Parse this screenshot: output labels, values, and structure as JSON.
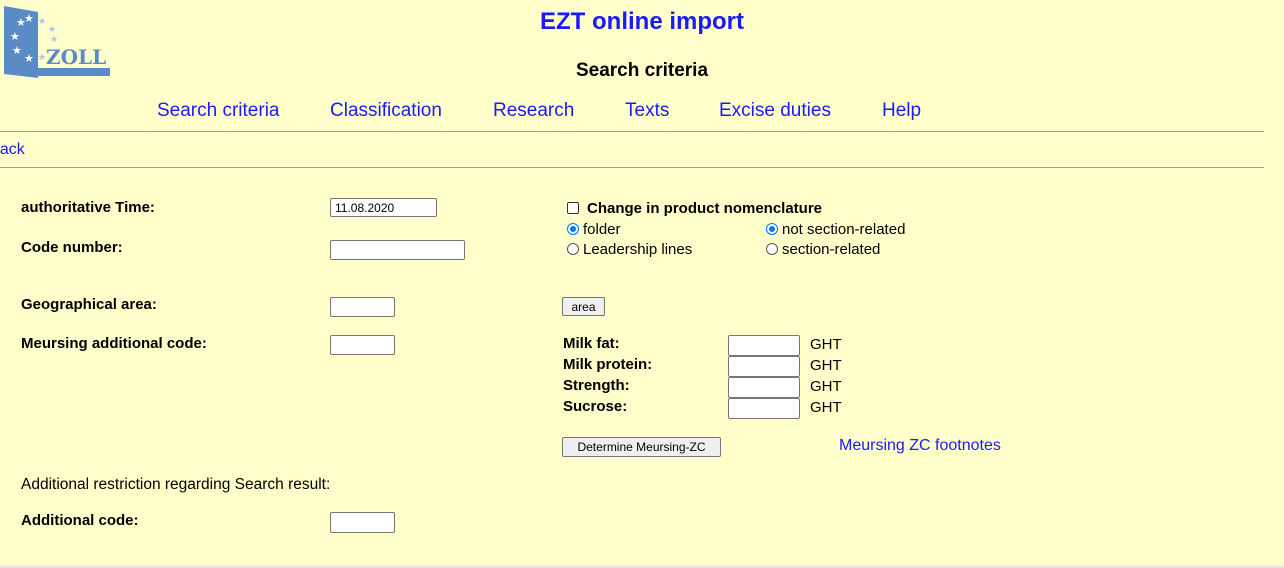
{
  "header": {
    "logo_text": "ZOLL",
    "app_title": "EZT online import",
    "page_title": "Search criteria"
  },
  "nav": {
    "items": [
      {
        "label": "Search criteria"
      },
      {
        "label": "Classification"
      },
      {
        "label": "Research"
      },
      {
        "label": "Texts"
      },
      {
        "label": "Excise duties"
      },
      {
        "label": "Help"
      }
    ],
    "back_label": "back"
  },
  "form": {
    "authoritative_time": {
      "label": "authoritative Time:",
      "value": "11.08.2020"
    },
    "code_number": {
      "label": "Code number:",
      "value": ""
    },
    "geographical_area": {
      "label": "Geographical area:",
      "value": "",
      "button_label": "area"
    },
    "meursing_code": {
      "label": "Meursing additional code:",
      "value": ""
    },
    "change_nomenclature": {
      "label": "Change in product nomenclature",
      "checked": false
    },
    "view_options": [
      {
        "label": "folder",
        "selected": true
      },
      {
        "label": "Leadership lines",
        "selected": false
      }
    ],
    "section_options": [
      {
        "label": "not section-related",
        "selected": true
      },
      {
        "label": "section-related",
        "selected": false
      }
    ],
    "meursing_fields": [
      {
        "label": "Milk fat:",
        "value": "",
        "unit": "GHT"
      },
      {
        "label": "Milk protein:",
        "value": "",
        "unit": "GHT"
      },
      {
        "label": "Strength:",
        "value": "",
        "unit": "GHT"
      },
      {
        "label": "Sucrose:",
        "value": "",
        "unit": "GHT"
      }
    ],
    "determine_button_label": "Determine Meursing-ZC",
    "footnotes_link": "Meursing ZC footnotes",
    "restriction_text": "Additional restriction regarding Search result:",
    "additional_code": {
      "label": "Additional code:",
      "value": ""
    }
  },
  "colors": {
    "background": "#ffffcc",
    "link": "#1a1aff",
    "logo_blue": "#4f81bd"
  }
}
